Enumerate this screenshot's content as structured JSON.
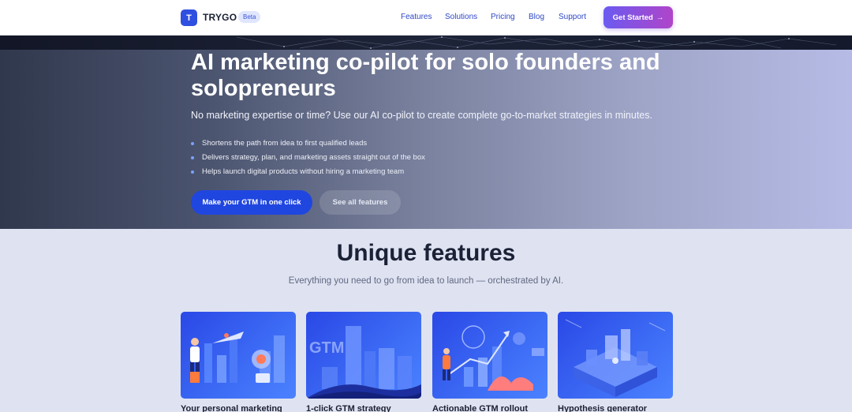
{
  "header": {
    "logo_letter": "T",
    "brand": "TRYGO",
    "badge": "Beta",
    "nav": [
      "Features",
      "Solutions",
      "Pricing",
      "Blog",
      "Support"
    ],
    "cta_label": "Get Started",
    "cta_arrow": "→"
  },
  "hero": {
    "title": "AI marketing co-pilot for solo founders and solopreneurs",
    "subtitle": "No marketing expertise or time? Use our AI co-pilot to create complete go-to-market strategies in minutes.",
    "bullets": [
      "Shortens the path from idea to first qualified leads",
      "Delivers strategy, plan, and marketing assets straight out of the box",
      "Helps launch digital products without hiring a marketing team"
    ],
    "primary_button": "Make your GTM in one click",
    "secondary_button": "See all features"
  },
  "features": {
    "title": "Unique features",
    "subtitle": "Everything you need to go from idea to launch — orchestrated by AI.",
    "cards": [
      {
        "title": "Your personal marketing",
        "icon": "marketer-illustration"
      },
      {
        "title": "1-click GTM strategy",
        "icon": "gtm-city-illustration",
        "image_text": "GTM"
      },
      {
        "title": "Actionable GTM rollout",
        "icon": "growth-chart-illustration"
      },
      {
        "title": "Hypothesis generator",
        "icon": "isometric-workspace-illustration"
      }
    ]
  },
  "colors": {
    "accent": "#2046e0",
    "cta_gradient_start": "#6a5af0",
    "cta_gradient_end": "#b045c9",
    "page_background": "#dfe3f1"
  }
}
